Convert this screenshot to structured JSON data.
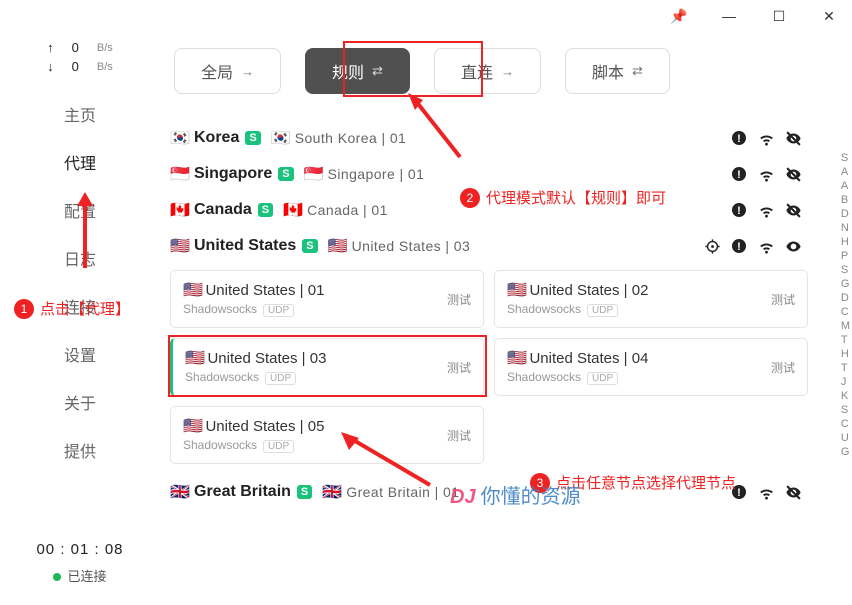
{
  "titlebar": {
    "pin": "📌",
    "min": "—",
    "max": "☐",
    "close": "✕"
  },
  "sidebar": {
    "up": {
      "arrow": "↑",
      "value": "0",
      "unit": "B/s"
    },
    "down": {
      "arrow": "↓",
      "value": "0",
      "unit": "B/s"
    },
    "items": [
      "主页",
      "代理",
      "配置",
      "日志",
      "连接",
      "设置",
      "关于",
      "提供"
    ],
    "timer": "00 : 01 : 08",
    "status": "已连接"
  },
  "modes": [
    {
      "label": "全局",
      "glyph": "→"
    },
    {
      "label": "规则",
      "glyph": "⇄",
      "active": true
    },
    {
      "label": "直连",
      "glyph": "→"
    },
    {
      "label": "脚本",
      "glyph": "⇄"
    }
  ],
  "groups": [
    {
      "flag": "🇰🇷",
      "name": "Korea",
      "tag": "S",
      "selFlag": "🇰🇷",
      "selected": "South Korea | 01"
    },
    {
      "flag": "🇸🇬",
      "name": "Singapore",
      "tag": "S",
      "selFlag": "🇸🇬",
      "selected": "Singapore | 01"
    },
    {
      "flag": "🇨🇦",
      "name": "Canada",
      "tag": "S",
      "selFlag": "🇨🇦",
      "selected": "Canada | 01"
    },
    {
      "flag": "🇺🇸",
      "name": "United States",
      "tag": "S",
      "selFlag": "🇺🇸",
      "selected": "United States | 03",
      "expanded": true
    },
    {
      "flag": "🇬🇧",
      "name": "Great Britain",
      "tag": "S",
      "selFlag": "🇬🇧",
      "selected": "Great Britain | 01"
    }
  ],
  "nodes": [
    {
      "flag": "🇺🇸",
      "name": "United States | 01",
      "proto": "Shadowsocks",
      "udp": "UDP",
      "test": "测试"
    },
    {
      "flag": "🇺🇸",
      "name": "United States | 02",
      "proto": "Shadowsocks",
      "udp": "UDP",
      "test": "测试"
    },
    {
      "flag": "🇺🇸",
      "name": "United States | 03",
      "proto": "Shadowsocks",
      "udp": "UDP",
      "test": "测试",
      "selected": true
    },
    {
      "flag": "🇺🇸",
      "name": "United States | 04",
      "proto": "Shadowsocks",
      "udp": "UDP",
      "test": "测试"
    },
    {
      "flag": "🇺🇸",
      "name": "United States | 05",
      "proto": "Shadowsocks",
      "udp": "UDP",
      "test": "测试"
    }
  ],
  "alpha": [
    "S",
    "A",
    "A",
    "B",
    "D",
    "N",
    "H",
    "P",
    "S",
    "G",
    "D",
    "C",
    "M",
    "T",
    "H",
    "T",
    "J",
    "K",
    "S",
    "C",
    "U",
    "G"
  ],
  "callouts": {
    "c1": {
      "num": "1",
      "text": "点击【代理】"
    },
    "c2": {
      "num": "2",
      "text": "代理模式默认【规则】即可"
    },
    "c3": {
      "num": "3",
      "text": "点击任意节点选择代理节点"
    }
  },
  "watermark": {
    "a": "DJ",
    "b": "你懂的资源"
  }
}
